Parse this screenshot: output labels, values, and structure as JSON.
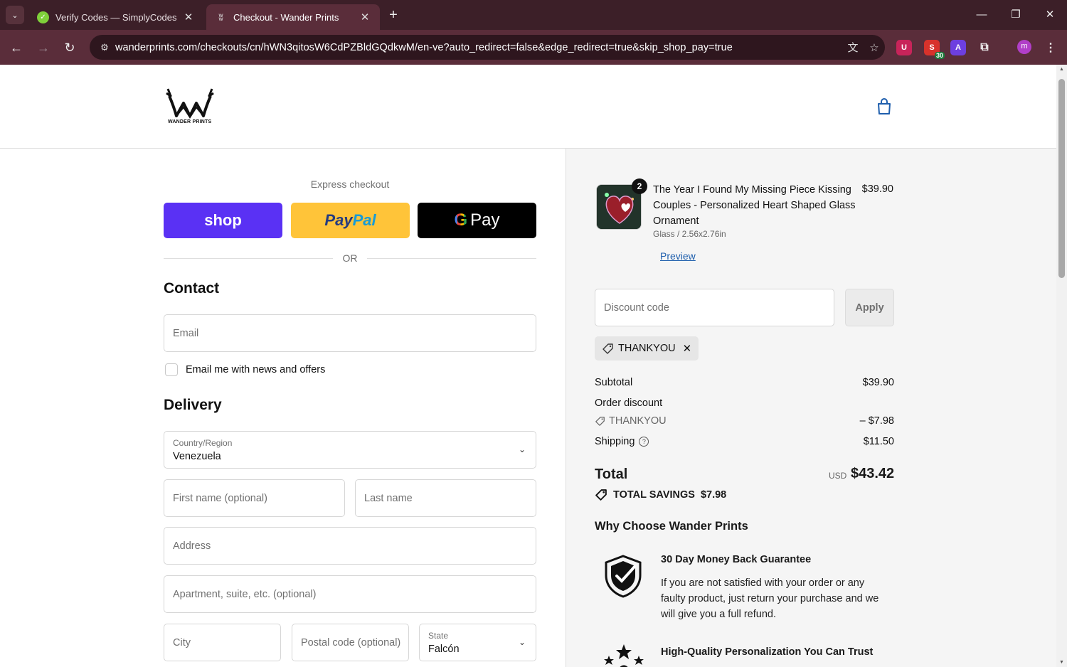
{
  "browser": {
    "tabs": [
      {
        "title": "Verify Codes — SimplyCodes",
        "active": false
      },
      {
        "title": "Checkout - Wander Prints",
        "active": true
      }
    ],
    "url": "wanderprints.com/checkouts/cn/hWN3qitosW6CdPZBldGQdkwM/en-ve?auto_redirect=false&edge_redirect=true&skip_shop_pay=true",
    "extension_badge": "30",
    "profile_initial": "m"
  },
  "header": {
    "logo_text": "WANDER PRINTS"
  },
  "express": {
    "title": "Express checkout",
    "shop_label": "shop",
    "paypal_part1": "Pay",
    "paypal_part2": "Pal",
    "gpay_g": "G",
    "gpay_label": "Pay",
    "or": "OR"
  },
  "contact": {
    "heading": "Contact",
    "email_placeholder": "Email",
    "news_label": "Email me with news and offers"
  },
  "delivery": {
    "heading": "Delivery",
    "country_label": "Country/Region",
    "country_value": "Venezuela",
    "first_name_placeholder": "First name (optional)",
    "last_name_placeholder": "Last name",
    "address_placeholder": "Address",
    "apartment_placeholder": "Apartment, suite, etc. (optional)",
    "city_placeholder": "City",
    "postal_placeholder": "Postal code (optional)",
    "state_label": "State",
    "state_value": "Falcón"
  },
  "summary": {
    "item": {
      "quantity": "2",
      "title": "The Year I Found My Missing Piece Kissing Couples - Personalized Heart Shaped Glass Ornament",
      "variant": "Glass / 2.56x2.76in",
      "preview": "Preview",
      "price": "$39.90"
    },
    "discount_placeholder": "Discount code",
    "apply": "Apply",
    "applied_code": "THANKYOU",
    "subtotal_label": "Subtotal",
    "subtotal_value": "$39.90",
    "order_discount_label": "Order discount",
    "discount_code": "THANKYOU",
    "discount_value": "– $7.98",
    "shipping_label": "Shipping",
    "shipping_value": "$11.50",
    "total_label": "Total",
    "currency": "USD",
    "total_value": "$43.42",
    "savings_label": "TOTAL SAVINGS",
    "savings_value": "$7.98",
    "why_heading": "Why Choose Wander Prints",
    "benefits": [
      {
        "title": "30 Day Money Back Guarantee",
        "body": "If you are not satisfied with your order or any faulty product, just return your purchase and we will give you a full refund."
      },
      {
        "title": "High-Quality Personalization You Can Trust"
      }
    ]
  },
  "colors": {
    "shop_purple": "#5a31f4",
    "paypal_yellow": "#ffc439",
    "link_blue": "#1f5fad",
    "chrome_bg": "#3c1f28"
  }
}
